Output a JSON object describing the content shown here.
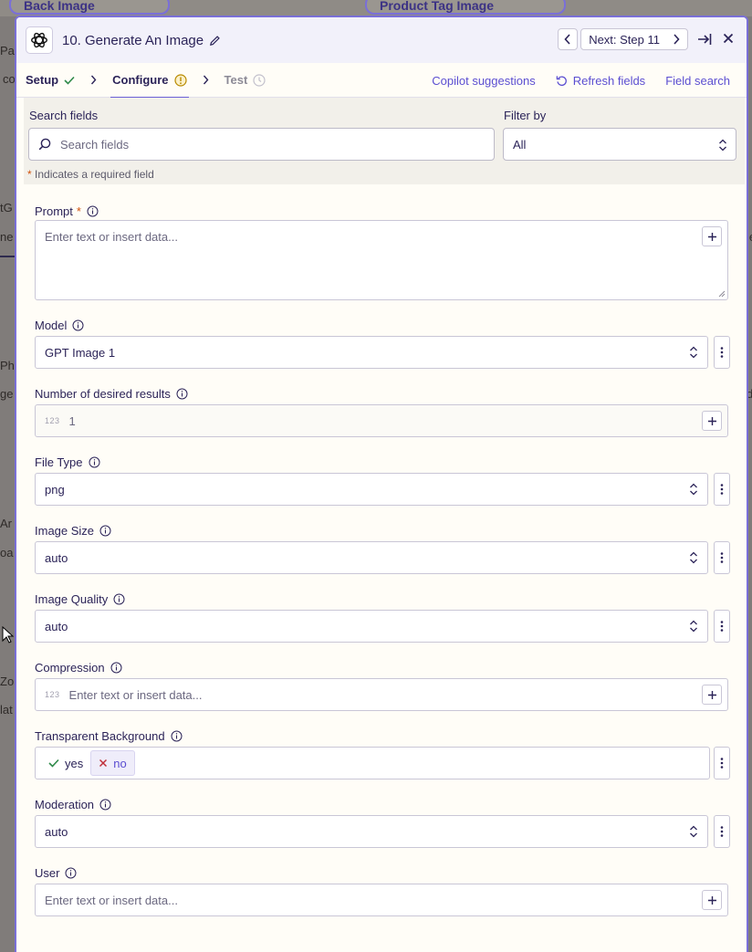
{
  "background": {
    "card_left": "Back Image",
    "card_right": "Product Tag Image",
    "fragments": [
      "Pa",
      "co",
      "tG",
      "ne",
      "Ph",
      "ge",
      "Ar",
      "oa",
      "Zo",
      "lat",
      "le",
      "d"
    ]
  },
  "header": {
    "title": "10. Generate An Image",
    "next_label": "Next: Step 11"
  },
  "tabs": {
    "setup": "Setup",
    "configure": "Configure",
    "test": "Test",
    "actions": {
      "copilot": "Copilot suggestions",
      "refresh": "Refresh fields",
      "field_search": "Field search"
    }
  },
  "search": {
    "label": "Search fields",
    "placeholder": "Search fields",
    "filter_label": "Filter by",
    "filter_value": "All",
    "required_note": "Indicates a required field",
    "required_star": "*"
  },
  "fields": {
    "prompt": {
      "label": "Prompt",
      "required": "*",
      "placeholder": "Enter text or insert data..."
    },
    "model": {
      "label": "Model",
      "value": "GPT Image 1"
    },
    "num_results": {
      "label": "Number of desired results",
      "type_tag": "123",
      "value": "1"
    },
    "file_type": {
      "label": "File Type",
      "value": "png"
    },
    "image_size": {
      "label": "Image Size",
      "value": "auto"
    },
    "image_quality": {
      "label": "Image Quality",
      "value": "auto"
    },
    "compression": {
      "label": "Compression",
      "type_tag": "123",
      "placeholder": "Enter text or insert data..."
    },
    "transparent_bg": {
      "label": "Transparent Background",
      "yes": "yes",
      "no": "no",
      "selected": "no"
    },
    "moderation": {
      "label": "Moderation",
      "value": "auto"
    },
    "user": {
      "label": "User",
      "placeholder": "Enter text or insert data..."
    }
  },
  "colors": {
    "accent": "#6a5fd6",
    "required": "#d1520b",
    "panel_bg": "#fffdf7",
    "header_bg": "#f2f1fa"
  }
}
